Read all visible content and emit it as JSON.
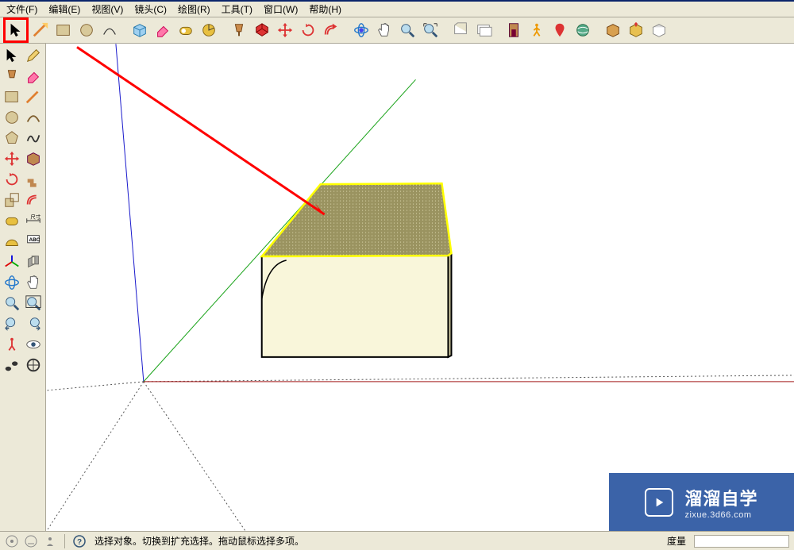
{
  "menu": {
    "file": "文件(F)",
    "edit": "编辑(E)",
    "view": "视图(V)",
    "camera": "镜头(C)",
    "draw": "绘图(R)",
    "tools": "工具(T)",
    "window": "窗口(W)",
    "help": "帮助(H)"
  },
  "status": {
    "hint": "选择对象。切换到扩充选择。拖动鼠标选择多项。",
    "measure_label": "度量"
  },
  "watermark": {
    "title": "溜溜自学",
    "sub": "zixue.3d66.com"
  },
  "top_tools": [
    "select",
    "line",
    "rect",
    "circle",
    "arc",
    "make-comp",
    "eraser",
    "tape",
    "protractor",
    "paint",
    "pushpull",
    "move",
    "rotate",
    "offset",
    "orbit",
    "pan",
    "zoom",
    "zoom-ext",
    "prev",
    "next",
    "outliner",
    "walk",
    "ge-place",
    "ge-toggle",
    "ge-textures",
    "ge",
    "export",
    "import",
    "plugins"
  ],
  "left_tools": [
    [
      "select",
      "pencil"
    ],
    [
      "paint",
      "eraser"
    ],
    [
      "rect",
      "line"
    ],
    [
      "circle",
      "arc"
    ],
    [
      "polygon",
      "freehand"
    ],
    [
      "comp-red",
      "pushpull"
    ],
    [
      "rotate-cw",
      "followme"
    ],
    [
      "scale",
      "offset"
    ],
    [
      "tape",
      "dimension"
    ],
    [
      "protractor",
      "text"
    ],
    [
      "axes",
      "planes"
    ],
    [
      "orbit",
      "pan"
    ],
    [
      "zoom",
      "zoom-ext"
    ],
    [
      "prev",
      "next"
    ],
    [
      "position",
      "look"
    ],
    [
      "walk",
      "section"
    ]
  ]
}
